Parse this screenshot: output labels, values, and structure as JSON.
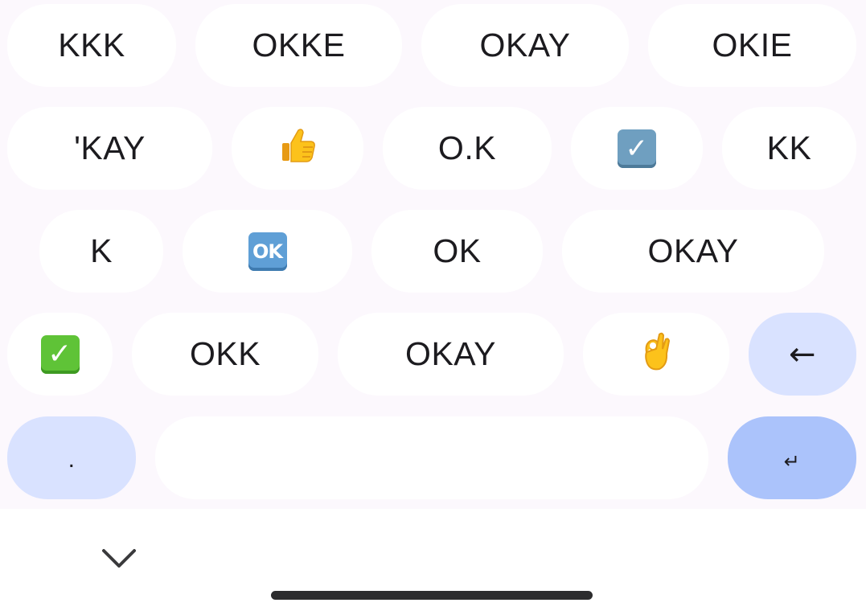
{
  "keyboard": {
    "rows": [
      [
        "KKK",
        "OKKE",
        "OKAY",
        "OKIE"
      ],
      [
        "'KAY",
        "thumbs-up",
        "O.K",
        "check-mark-button-gray",
        "KK"
      ],
      [
        "K",
        "ok-button",
        "OK",
        "OKAY"
      ],
      [
        "check-mark-button-green",
        "OKK",
        "OKAY",
        "ok-hand",
        "backspace"
      ],
      [
        "period",
        "space",
        "enter"
      ]
    ],
    "row1": {
      "k1": "KKK",
      "k2": "OKKE",
      "k3": "OKAY",
      "k4": "OKIE"
    },
    "row2": {
      "k1": "'KAY",
      "k2_emoji": "👍",
      "k3": "O.K",
      "k4_emoji": "☑️",
      "k5": "KK"
    },
    "row3": {
      "k1": "K",
      "k2_emoji": "🆗",
      "k2_badge_text": "OK",
      "k3": "OK",
      "k4": "OKAY"
    },
    "row4": {
      "k1_emoji": "✅",
      "k2": "OKK",
      "k3": "OKAY",
      "k4_emoji": "👌",
      "backspace": "←"
    },
    "row5": {
      "period": ".",
      "space": "",
      "enter": "↵"
    }
  },
  "icons": {
    "thumbs_up": "thumbs-up-icon",
    "ballot_check": "check-mark-button-gray-icon",
    "ok_button": "ok-button-icon",
    "check_green": "check-mark-button-green-icon",
    "ok_hand": "ok-hand-icon",
    "backspace": "backspace-arrow-icon",
    "enter": "enter-icon",
    "hide_keyboard": "chevron-down-icon"
  },
  "colors": {
    "keyboard_background": "#fcf8fd",
    "key_background": "#ffffff",
    "function_key_background": "#d9e2ff",
    "enter_key_background": "#abc3fb",
    "key_text": "#1c1b1f",
    "home_indicator": "#2c2c2e"
  }
}
